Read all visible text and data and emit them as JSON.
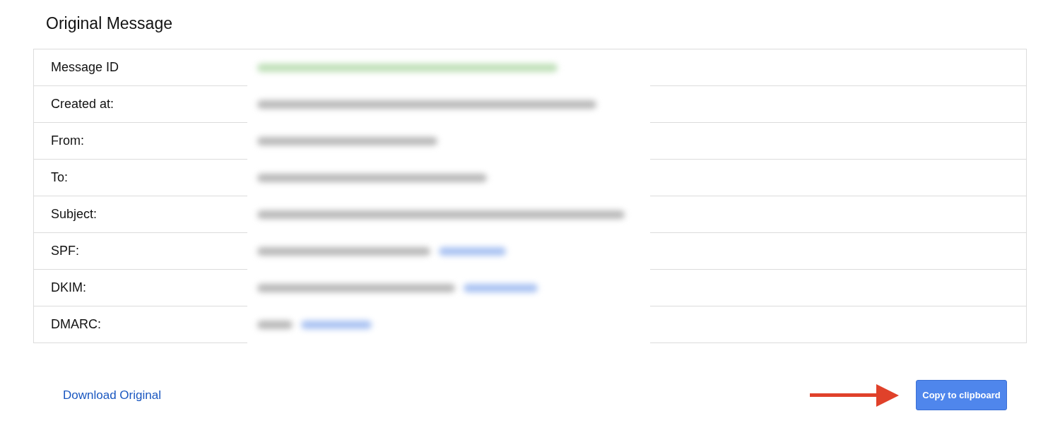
{
  "title": "Original Message",
  "rows": [
    {
      "label": "Message ID",
      "kind": "highlight"
    },
    {
      "label": "Created at:",
      "kind": "plain"
    },
    {
      "label": "From:",
      "kind": "plain"
    },
    {
      "label": "To:",
      "kind": "plain"
    },
    {
      "label": "Subject:",
      "kind": "plain"
    },
    {
      "label": "SPF:",
      "kind": "link"
    },
    {
      "label": "DKIM:",
      "kind": "link"
    },
    {
      "label": "DMARC:",
      "kind": "link"
    }
  ],
  "download_link": "Download Original",
  "copy_button": "Copy to clipboard",
  "callout_arrow": true
}
